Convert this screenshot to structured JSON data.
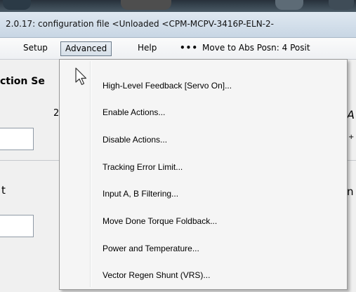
{
  "window": {
    "title": "2.0.17:  configuration file <Unloaded <CPM-MCPV-3416P-ELN-2-"
  },
  "menu": {
    "setup": "Setup",
    "advanced": "Advanced",
    "help": "Help",
    "move_dots": "•••",
    "move": "Move to Abs Posn: 4 Posit"
  },
  "background": {
    "section_title": "ction Se",
    "digit": "2",
    "letter_t": "t",
    "letter_n": "n",
    "letter_a": "A",
    "plus_fragment": "+"
  },
  "dropdown": {
    "items": [
      {
        "label": "High-Level Feedback [Servo On]..."
      },
      {
        "label": "Enable Actions..."
      },
      {
        "label": "Disable Actions..."
      },
      {
        "label": "Tracking Error Limit..."
      },
      {
        "label": "Input A, B Filtering..."
      },
      {
        "label": "Move Done Torque Foldback..."
      },
      {
        "label": "Power and Temperature..."
      },
      {
        "label": "Vector Regen Shunt (VRS)..."
      }
    ]
  },
  "icons": {
    "cursor": "mouse-pointer-icon"
  }
}
